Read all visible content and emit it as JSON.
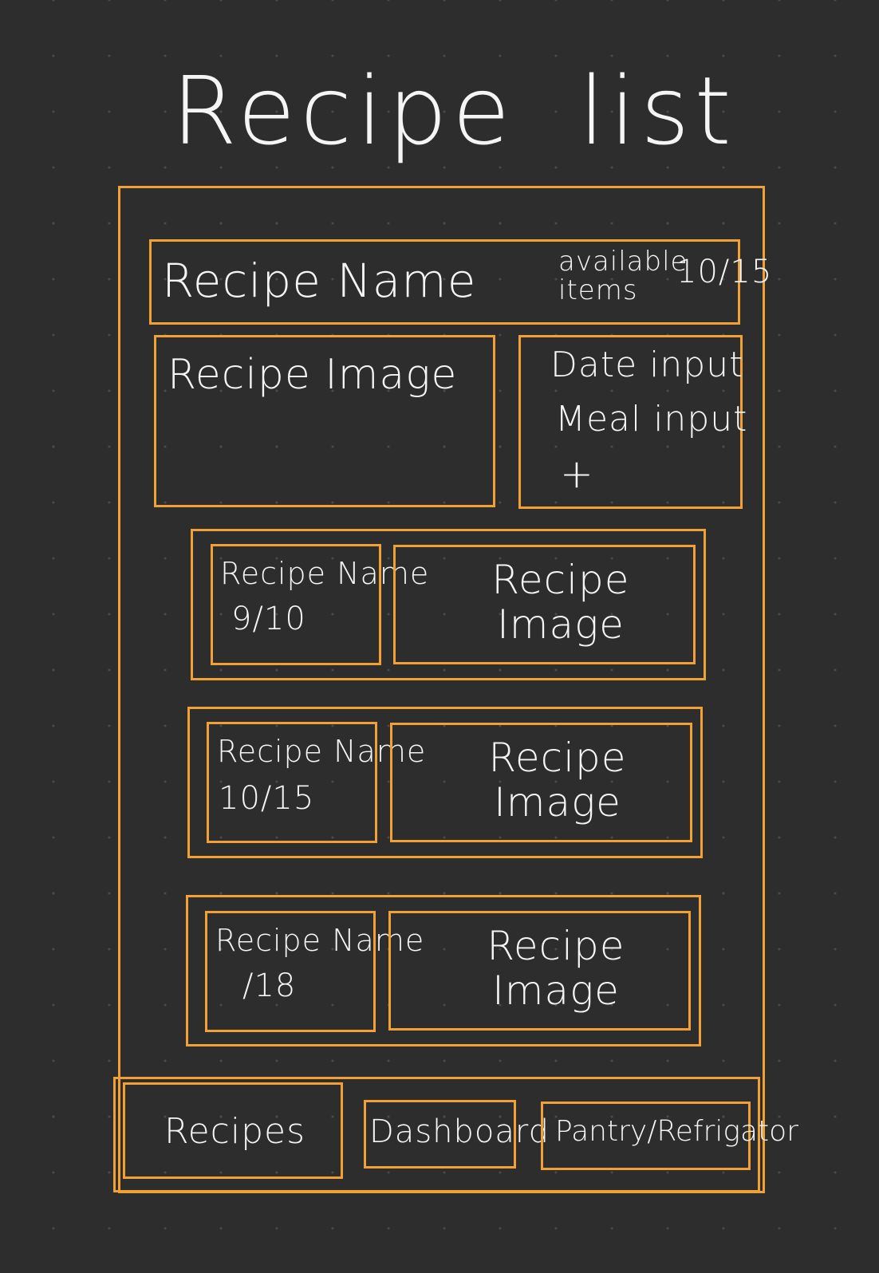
{
  "page": {
    "title_word1": "Recipe",
    "title_word2": "list",
    "accent_color": "#f0a035",
    "background_color": "#2d2d2d"
  },
  "featured": {
    "name": "Recipe Name",
    "available_label": "available items",
    "available_count": "10/15",
    "image_label": "Recipe Image",
    "date_input": "Date input",
    "meal_input": "Meal input",
    "add_symbol": "+"
  },
  "recipes": [
    {
      "name": "Recipe Name",
      "count": "9/10",
      "image_label": "Recipe Image"
    },
    {
      "name": "Recipe Name",
      "count": "10/15",
      "image_label": "Recipe Image"
    },
    {
      "name": "Recipe Name",
      "count": "/18",
      "image_label": "Recipe Image"
    }
  ],
  "nav": {
    "recipes": "Recipes",
    "dashboard": "Dashboard",
    "pantry": "Pantry/Refrigator"
  }
}
